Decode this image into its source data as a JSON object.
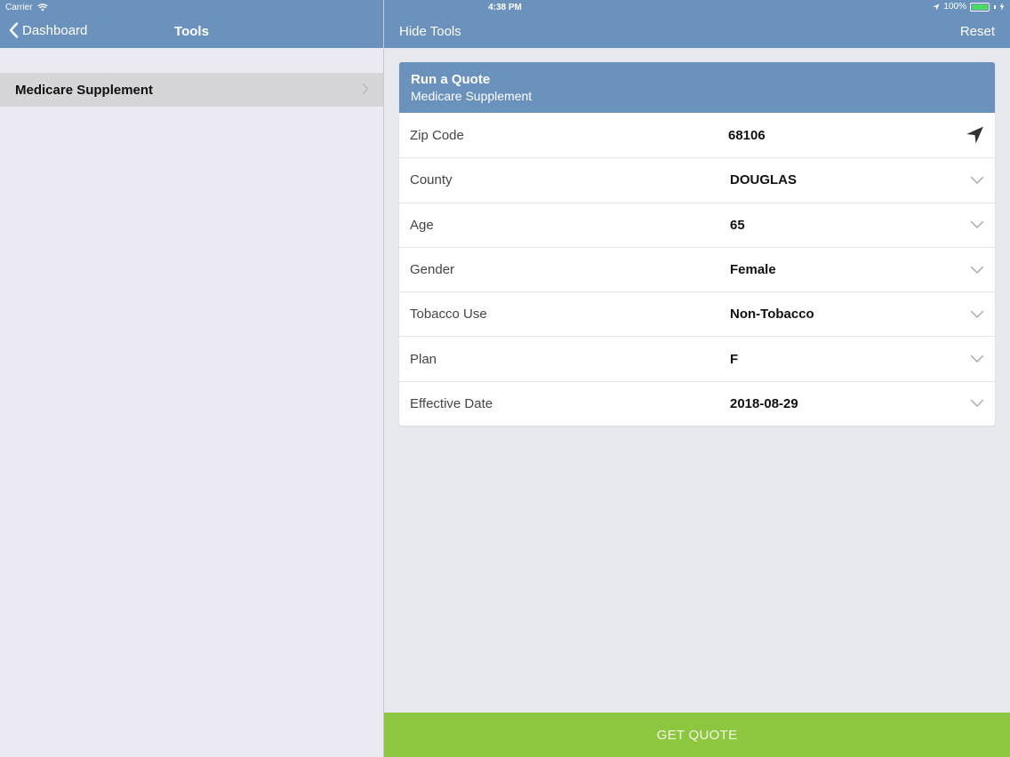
{
  "status": {
    "carrier": "Carrier",
    "time": "4:38 PM",
    "battery": "100%"
  },
  "master_nav": {
    "back_label": "Dashboard",
    "title": "Tools"
  },
  "detail_nav": {
    "left_label": "Hide Tools",
    "right_label": "Reset"
  },
  "master_list": {
    "items": [
      {
        "label": "Medicare Supplement"
      }
    ]
  },
  "quote_card": {
    "title": "Run a Quote",
    "subtitle": "Medicare Supplement",
    "rows": [
      {
        "label": "Zip Code",
        "value": "68106",
        "icon": "location-arrow-icon"
      },
      {
        "label": "County",
        "value": "DOUGLAS",
        "icon": "chevron-down-icon"
      },
      {
        "label": "Age",
        "value": "65",
        "icon": "chevron-down-icon"
      },
      {
        "label": "Gender",
        "value": "Female",
        "icon": "chevron-down-icon"
      },
      {
        "label": "Tobacco Use",
        "value": "Non-Tobacco",
        "icon": "chevron-down-icon"
      },
      {
        "label": "Plan",
        "value": "F",
        "icon": "chevron-down-icon"
      },
      {
        "label": "Effective Date",
        "value": "2018-08-29",
        "icon": "chevron-down-icon"
      }
    ]
  },
  "footer": {
    "button_label": "GET QUOTE"
  },
  "colors": {
    "nav_blue": "#6a92bc",
    "button_green": "#8dc63f",
    "background": "#ebeaf2"
  }
}
